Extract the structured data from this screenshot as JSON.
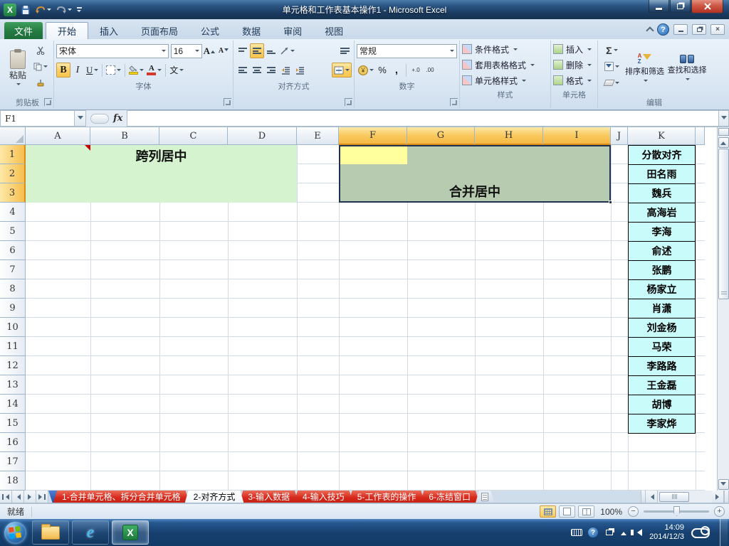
{
  "window": {
    "title": "单元格和工作表基本操作1 - Microsoft Excel"
  },
  "ribbon": {
    "file_tab": "文件",
    "tabs": [
      {
        "label": "开始",
        "active": true
      },
      {
        "label": "插入"
      },
      {
        "label": "页面布局"
      },
      {
        "label": "公式"
      },
      {
        "label": "数据"
      },
      {
        "label": "审阅"
      },
      {
        "label": "视图"
      }
    ],
    "clipboard": {
      "label": "剪贴板",
      "paste": "粘贴"
    },
    "font": {
      "label": "字体",
      "name": "宋体",
      "size": "16"
    },
    "alignment": {
      "label": "对齐方式"
    },
    "number": {
      "label": "数字",
      "format": "常规"
    },
    "styles": {
      "label": "样式",
      "items": [
        "条件格式",
        "套用表格格式",
        "单元格样式"
      ]
    },
    "cells": {
      "label": "单元格",
      "items": [
        "插入",
        "删除",
        "格式"
      ]
    },
    "editing": {
      "label": "编辑",
      "sort": "排序和筛选",
      "find": "查找和选择"
    }
  },
  "icons": {
    "bold": "B",
    "italic": "I",
    "underline": "U",
    "grow_font": "A",
    "shrink_font": "A",
    "font_color": "A",
    "phonetic": "文",
    "currency": "¥",
    "percent": "%",
    "comma": ",",
    "inc_decimal": "+.0",
    "dec_decimal": ".00",
    "sum": "Σ",
    "sort_a": "A",
    "sort_z": "Z",
    "fx": "fx",
    "help": "?",
    "orientation": "ab"
  },
  "formula_bar": {
    "name_box": "F1",
    "formula": ""
  },
  "grid": {
    "columns": [
      {
        "key": "A",
        "label": "A"
      },
      {
        "key": "B",
        "label": "B"
      },
      {
        "key": "C",
        "label": "C"
      },
      {
        "key": "D",
        "label": "D"
      },
      {
        "key": "E",
        "label": "E"
      },
      {
        "key": "F",
        "label": "F",
        "sel": true
      },
      {
        "key": "G",
        "label": "G",
        "sel": true
      },
      {
        "key": "H",
        "label": "H",
        "sel": true
      },
      {
        "key": "I",
        "label": "I",
        "sel": true
      },
      {
        "key": "J",
        "label": "J"
      },
      {
        "key": "K",
        "label": "K"
      },
      {
        "key": "L",
        "label": ""
      }
    ],
    "rows": [
      {
        "n": "1",
        "sel": true
      },
      {
        "n": "2",
        "sel": true
      },
      {
        "n": "3",
        "sel": true
      },
      {
        "n": "4"
      },
      {
        "n": "5"
      },
      {
        "n": "6"
      },
      {
        "n": "7"
      },
      {
        "n": "8"
      },
      {
        "n": "9"
      },
      {
        "n": "10"
      },
      {
        "n": "11"
      },
      {
        "n": "12"
      },
      {
        "n": "13"
      },
      {
        "n": "14"
      },
      {
        "n": "15"
      },
      {
        "n": "16"
      },
      {
        "n": "17"
      },
      {
        "n": "18"
      }
    ],
    "span_center_text": "跨列居中",
    "merge_center_text": "合并居中",
    "k_names": [
      "分散对齐",
      "田名雨",
      "魏兵",
      "高海岩",
      "李海",
      "俞述",
      "张鹏",
      "杨家立",
      "肖潇",
      "刘金杨",
      "马荣",
      "李路路",
      "王金磊",
      "胡博",
      "李家烨"
    ]
  },
  "sheet_tabs": [
    {
      "label": "1-合并单元格、拆分合并单元格"
    },
    {
      "label": "2-对齐方式",
      "active": true
    },
    {
      "label": "3-输入数据"
    },
    {
      "label": "4-输入技巧"
    },
    {
      "label": "5-工作表的操作"
    },
    {
      "label": "6-冻结窗口"
    }
  ],
  "status_bar": {
    "ready": "就绪",
    "zoom": "100%"
  },
  "taskbar": {
    "time": "14:09",
    "date": "2014/12/3"
  },
  "colors": {
    "header_selected": "#f6b844",
    "selection_fill": "#b7cbb0",
    "active_cell": "#ffff9e",
    "green_fill": "#d6f3d0",
    "cyan_fill": "#c9fbfb",
    "sheet_tab_red": "#d5281b",
    "file_tab_green": "#257a43",
    "taskbar_blue": "#17406f"
  }
}
